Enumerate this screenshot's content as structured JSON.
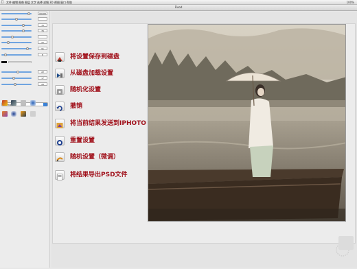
{
  "menubar": {
    "items": [
      "文件",
      "编辑",
      "图像",
      "图层",
      "文字",
      "选择",
      "滤镜",
      "3D",
      "视图",
      "窗口",
      "帮助"
    ],
    "status": "100%"
  },
  "window": {
    "title": "Flood"
  },
  "controls": {
    "values": [
      "00408",
      "",
      "76",
      "76",
      "",
      "22",
      "91",
      "8",
      "",
      "22",
      "17",
      "28"
    ],
    "blend_mode": "normal"
  },
  "actions": [
    {
      "icon": "save-settings-icon",
      "label": "将设置保存到磁盘"
    },
    {
      "icon": "load-settings-icon",
      "label": "从磁盘加载设置"
    },
    {
      "icon": "randomize-icon",
      "label": "随机化设置"
    },
    {
      "icon": "undo-icon",
      "label": "撤销"
    },
    {
      "icon": "send-iphoto-icon",
      "label": "将当前结果发送到IPHOTO"
    },
    {
      "icon": "reset-icon",
      "label": "重置设置"
    },
    {
      "icon": "random-tweak-icon",
      "label": "随机设置（微调）"
    },
    {
      "icon": "export-psd-icon",
      "label": "将结果导出PSD文件"
    }
  ],
  "colors": {
    "action_label": "#a0101a",
    "slider": "#6fa4e0",
    "select_arrow": "#3b82d6"
  }
}
